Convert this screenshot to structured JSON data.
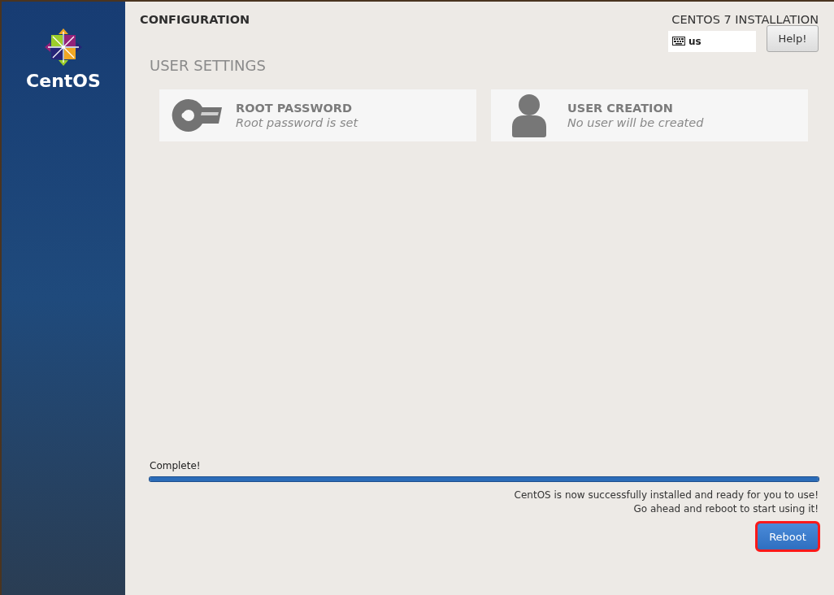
{
  "sidebar": {
    "logo_text": "CentOS"
  },
  "header": {
    "title": "CONFIGURATION",
    "product": "CENTOS 7 INSTALLATION",
    "keyboard_layout": "us",
    "help_button": "Help!"
  },
  "section": {
    "title": "USER SETTINGS"
  },
  "spokes": [
    {
      "kind": "key",
      "title": "ROOT PASSWORD",
      "status": "Root password is set"
    },
    {
      "kind": "user",
      "title": "USER CREATION",
      "status": "No user will be created"
    }
  ],
  "progress": {
    "label": "Complete!",
    "level": 1,
    "messages": [
      "CentOS is now successfully installed and ready for you to use!",
      "Go ahead and reboot to start using it!"
    ]
  },
  "reboot_button": {
    "label": "Reboot",
    "highlighted": true
  }
}
